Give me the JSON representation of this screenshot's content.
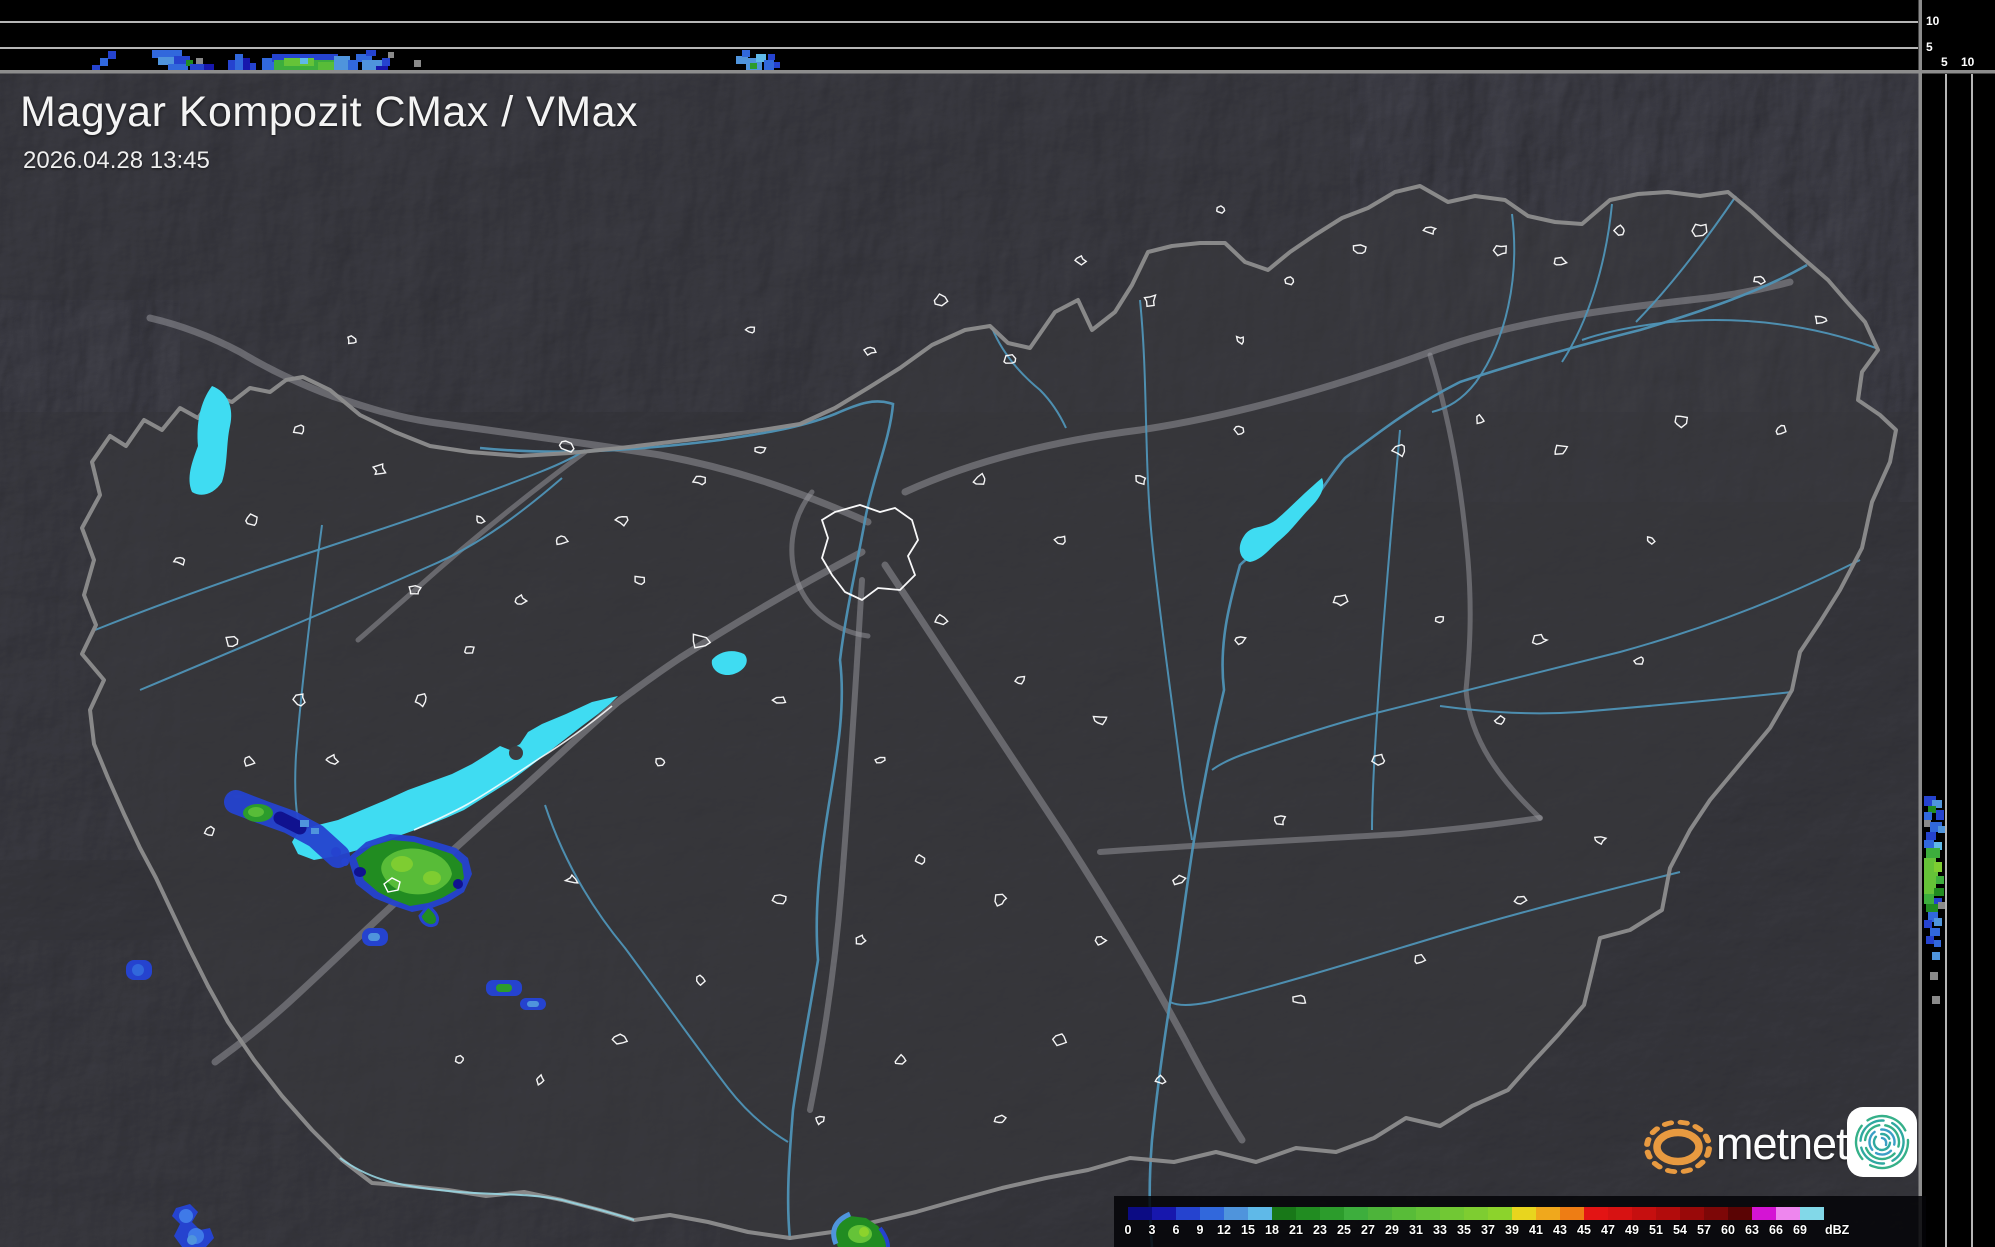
{
  "header": {
    "title": "Magyar Kompozit CMax / VMax",
    "datetime": "2026.04.28 13:45"
  },
  "profile_axes": {
    "top_strip": {
      "labels": [
        "10",
        "5"
      ]
    },
    "right_strip": {
      "labels": [
        "5",
        "10"
      ]
    }
  },
  "legend": {
    "unit": "dBZ",
    "stops": [
      {
        "label": "0",
        "color": "#0c0c84"
      },
      {
        "label": "3",
        "color": "#1717ad"
      },
      {
        "label": "6",
        "color": "#2543cf"
      },
      {
        "label": "9",
        "color": "#3168dc"
      },
      {
        "label": "12",
        "color": "#4f94dc"
      },
      {
        "label": "15",
        "color": "#5fb9e8"
      },
      {
        "label": "18",
        "color": "#187818"
      },
      {
        "label": "21",
        "color": "#218c21"
      },
      {
        "label": "23",
        "color": "#2c9c2c"
      },
      {
        "label": "25",
        "color": "#3dae3d"
      },
      {
        "label": "27",
        "color": "#4db43a"
      },
      {
        "label": "29",
        "color": "#58bc38"
      },
      {
        "label": "31",
        "color": "#65c338"
      },
      {
        "label": "33",
        "color": "#71c834"
      },
      {
        "label": "35",
        "color": "#7ecd31"
      },
      {
        "label": "37",
        "color": "#8cd32c"
      },
      {
        "label": "39",
        "color": "#e8d51e"
      },
      {
        "label": "41",
        "color": "#f0a81c"
      },
      {
        "label": "43",
        "color": "#ee7d14"
      },
      {
        "label": "45",
        "color": "#e31414"
      },
      {
        "label": "47",
        "color": "#d71212"
      },
      {
        "label": "49",
        "color": "#c60f0f"
      },
      {
        "label": "51",
        "color": "#b20c0c"
      },
      {
        "label": "54",
        "color": "#990909"
      },
      {
        "label": "57",
        "color": "#7d0707"
      },
      {
        "label": "60",
        "color": "#5a0404"
      },
      {
        "label": "63",
        "color": "#d414d4"
      },
      {
        "label": "66",
        "color": "#ee86ee"
      },
      {
        "label": "69",
        "color": "#82d8e8"
      }
    ]
  },
  "logo": {
    "brand": "metnet"
  },
  "colors": {
    "lake_water": "#3fdcf2",
    "river": "#4f94b6",
    "country_border": "#8d8d8d",
    "road": "#9a9aa0",
    "town_outline": "#ffffff",
    "terrain": "#3c3c40",
    "panel_background": "#000000"
  }
}
